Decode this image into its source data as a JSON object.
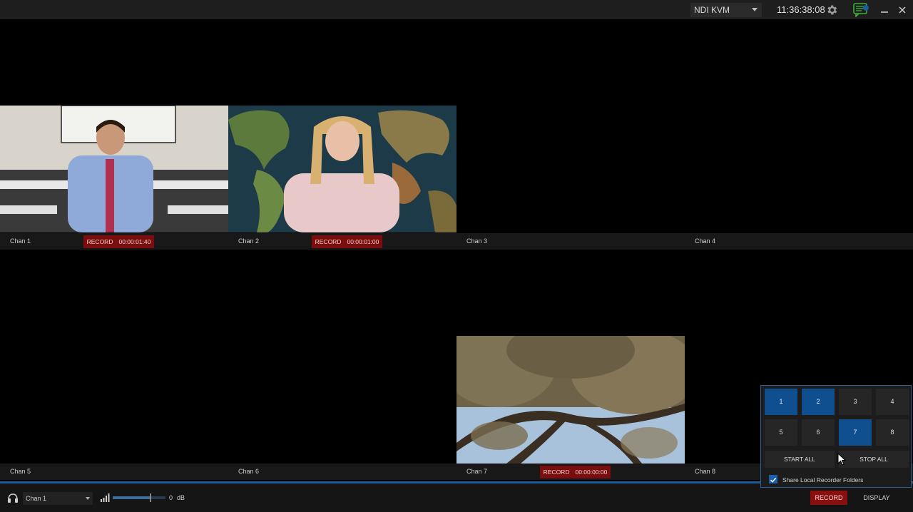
{
  "topbar": {
    "source": "NDI KVM",
    "clock": "11:36:38:08",
    "icons": [
      "gear-icon",
      "chat-icon",
      "minimize-icon",
      "close-icon"
    ]
  },
  "channels": [
    {
      "label": "Chan 1",
      "recording": true,
      "record_label": "RECORD",
      "time": "00:00:01:40"
    },
    {
      "label": "Chan 2",
      "recording": true,
      "record_label": "RECORD",
      "time": "00:00:01:00"
    },
    {
      "label": "Chan 3",
      "recording": false
    },
    {
      "label": "Chan 4",
      "recording": false
    },
    {
      "label": "Chan 5",
      "recording": false
    },
    {
      "label": "Chan 6",
      "recording": false
    },
    {
      "label": "Chan 7",
      "recording": true,
      "record_label": "RECORD",
      "time": "00:00:00:00"
    },
    {
      "label": "Chan 8",
      "recording": false
    }
  ],
  "bottombar": {
    "monitor_channel": "Chan 1",
    "volume_value": "0",
    "volume_unit": "dB",
    "volume_level": 0.7,
    "record_label": "RECORD",
    "display_label": "DISPLAY"
  },
  "panel": {
    "numbers": [
      {
        "label": "1",
        "active": true
      },
      {
        "label": "2",
        "active": true
      },
      {
        "label": "3",
        "active": false
      },
      {
        "label": "4",
        "active": false
      },
      {
        "label": "5",
        "active": false
      },
      {
        "label": "6",
        "active": false
      },
      {
        "label": "7",
        "active": true
      },
      {
        "label": "8",
        "active": false
      }
    ],
    "start_all": "START ALL",
    "stop_all": "STOP ALL",
    "share_label": "Share Local Recorder Folders",
    "share_checked": true
  },
  "colors": {
    "accent": "#1a5c9e",
    "record": "#7a0d0d",
    "panel_active": "#0f4f8f"
  }
}
